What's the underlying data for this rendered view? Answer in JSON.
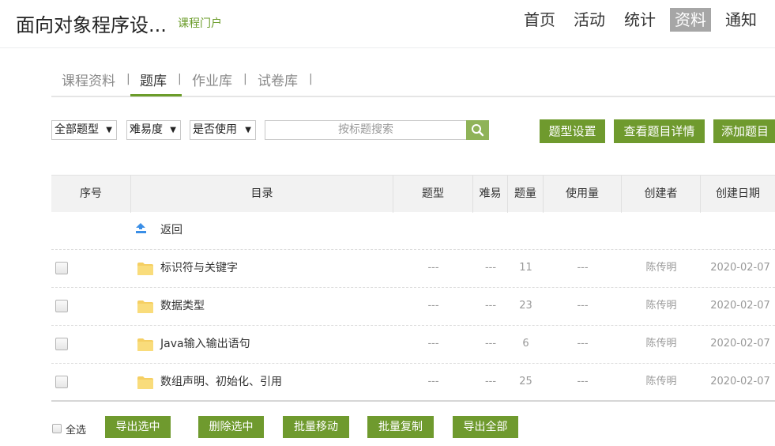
{
  "header": {
    "course_title": "面向对象程序设...",
    "portal_link": "课程门户",
    "nav": [
      {
        "label": "首页"
      },
      {
        "label": "活动"
      },
      {
        "label": "统计"
      },
      {
        "label": "资料",
        "active": true
      },
      {
        "label": "通知"
      }
    ]
  },
  "subtabs": {
    "items": [
      {
        "label": "课程资料"
      },
      {
        "label": "题库",
        "active": true
      },
      {
        "label": "作业库"
      },
      {
        "label": "试卷库"
      }
    ],
    "separator": "|"
  },
  "filters": {
    "type_select": "全部题型",
    "difficulty_select": "难易度",
    "usage_select": "是否使用",
    "search_placeholder": "按标题搜索",
    "caret": "▼"
  },
  "actions": {
    "type_settings": "题型设置",
    "view_details": "查看题目详情",
    "add_question": "添加题目"
  },
  "table": {
    "headers": [
      "序号",
      "目录",
      "题型",
      "难易",
      "题量",
      "使用量",
      "创建者",
      "创建日期"
    ],
    "back_label": "返回",
    "rows": [
      {
        "name": "标识符与关键字",
        "type": "---",
        "difficulty": "---",
        "count": "11",
        "usage": "---",
        "creator": "陈传明",
        "date": "2020-02-07"
      },
      {
        "name": "数据类型",
        "type": "---",
        "difficulty": "---",
        "count": "23",
        "usage": "---",
        "creator": "陈传明",
        "date": "2020-02-07"
      },
      {
        "name": "Java输入输出语句",
        "type": "---",
        "difficulty": "---",
        "count": "6",
        "usage": "---",
        "creator": "陈传明",
        "date": "2020-02-07"
      },
      {
        "name": "数组声明、初始化、引用",
        "type": "---",
        "difficulty": "---",
        "count": "25",
        "usage": "---",
        "creator": "陈传明",
        "date": "2020-02-07"
      }
    ]
  },
  "footer": {
    "select_all": "全选",
    "export_selected": "导出选中",
    "delete_selected": "删除选中",
    "batch_move": "批量移动",
    "batch_copy": "批量复制",
    "export_all": "导出全部"
  },
  "colors": {
    "accent": "#6f9a2e",
    "link": "#6b9c2a",
    "folder": "#f5cf63",
    "back_arrow": "#3a8ee6"
  },
  "icons": {
    "search": "search-icon",
    "folder": "folder-icon",
    "back": "back-arrow-icon"
  }
}
